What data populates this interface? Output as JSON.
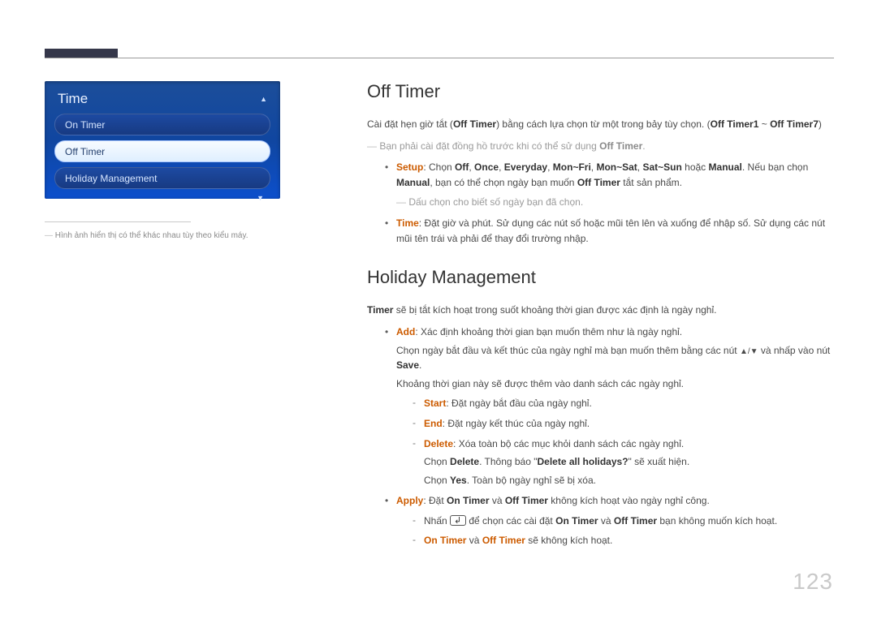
{
  "page_number": "123",
  "menu": {
    "title": "Time",
    "items": [
      {
        "label": "On Timer",
        "selected": false
      },
      {
        "label": "Off Timer",
        "selected": true
      },
      {
        "label": "Holiday Management",
        "selected": false
      }
    ]
  },
  "side_caption": "Hình ảnh hiển thị có thể khác nhau tùy theo kiểu máy.",
  "section1": {
    "heading": "Off Timer",
    "intro_pre": "Cài đặt hẹn giờ tắt (",
    "intro_bold1": "Off Timer",
    "intro_mid": ") bằng cách lựa chọn từ một trong bảy tùy chọn. (",
    "intro_bold2": "Off Timer1",
    "intro_tilde": " ~ ",
    "intro_bold3": "Off Timer7",
    "intro_end": ")",
    "note1_pre": "Bạn phải cài đặt đồng hồ trước khi có thể sử dụng ",
    "note1_bold": "Off Timer",
    "note1_post": ".",
    "setup_label": "Setup",
    "setup_colon": ": Chọn ",
    "opts": [
      "Off",
      "Once",
      "Everyday",
      "Mon~Fri",
      "Mon~Sat",
      "Sat~Sun"
    ],
    "setup_or": " hoặc ",
    "manual": "Manual",
    "setup_tail_pre": ". Nếu bạn chọn ",
    "setup_tail_post": ", bạn có thể chọn ngày bạn muốn ",
    "setup_tail_off": "Off Timer",
    "setup_tail_end": " tắt sản phẩm.",
    "setup_sub_note": "Dấu chọn cho biết số ngày bạn đã chọn.",
    "time_label": "Time",
    "time_text": ": Đặt giờ và phút. Sử dụng các nút số hoặc mũi tên lên và xuống để nhập số. Sử dụng các nút mũi tên trái và phải để thay đổi trường nhập."
  },
  "section2": {
    "heading": "Holiday Management",
    "p1_bold": "Timer",
    "p1_text": " sẽ bị tắt kích hoạt trong suốt khoảng thời gian được xác định là ngày nghỉ.",
    "add_label": "Add",
    "add_text": ": Xác định khoảng thời gian bạn muốn thêm như là ngày nghỉ.",
    "add_line2_pre": "Chọn ngày bắt đầu và kết thúc của ngày nghỉ mà bạn muốn thêm bằng các nút ",
    "add_arrows": "▲/▼",
    "add_line2_mid": " và nhấp vào nút ",
    "save": "Save",
    "add_line2_end": ".",
    "add_line3": "Khoảng thời gian này sẽ được thêm vào danh sách các ngày nghỉ.",
    "start_label": "Start",
    "start_text": ": Đặt ngày bắt đầu của ngày nghỉ.",
    "end_label": "End",
    "end_text": ": Đặt ngày kết thúc của ngày nghỉ.",
    "delete_label": "Delete",
    "delete_text": ": Xóa toàn bộ các mục khỏi danh sách các ngày nghỉ.",
    "del_line2_pre": "Chọn ",
    "del_line2_msg_pre": ". Thông báo \"",
    "del_all_msg": "Delete all holidays?",
    "del_line2_msg_post": "\" sẽ xuất hiện.",
    "del_line3_pre": "Chọn ",
    "yes": "Yes",
    "del_line3_post": ". Toàn bộ ngày nghỉ sẽ bị xóa.",
    "apply_label": "Apply",
    "apply_pre": ": Đặt ",
    "on_timer": "On Timer",
    "and": " và ",
    "off_timer": "Off Timer",
    "apply_post": " không kích hoạt vào ngày nghỉ công.",
    "apply_sub1_pre": "Nhấn ",
    "apply_sub1_mid": " để chọn các cài đặt ",
    "apply_sub1_post": " bạn không muốn kích hoạt.",
    "apply_sub2_pre": "",
    "apply_sub2_mid": " và ",
    "apply_sub2_post": " sẽ không kích hoạt."
  }
}
